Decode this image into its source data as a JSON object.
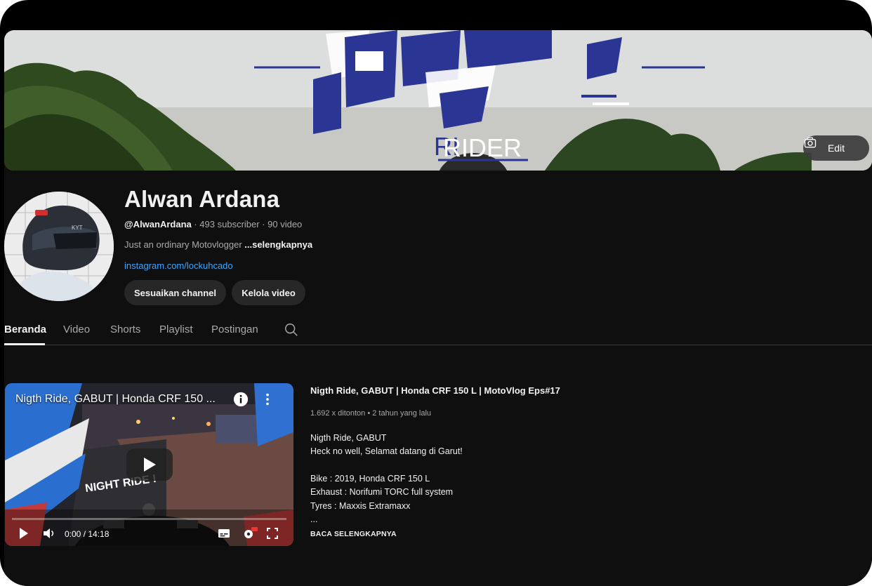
{
  "banner": {
    "overlay_text": "RIDER",
    "edit_label": "Edit"
  },
  "channel": {
    "name": "Alwan Ardana",
    "handle": "@AlwanArdana",
    "stats": " · 493 subscriber · 90 video",
    "description": "Just an ordinary Motovlogger ",
    "more_label": "...selengkapnya",
    "link": "instagram.com/lockuhcado",
    "buttons": {
      "customize": "Sesuaikan channel",
      "manage": "Kelola video"
    }
  },
  "tabs": [
    "Beranda",
    "Video",
    "Shorts",
    "Playlist",
    "Postingan"
  ],
  "featured_video": {
    "player_title": "Nigth Ride, GABUT | Honda CRF 150 ...",
    "title": "Nigth Ride, GABUT | Honda CRF 150 L | MotoVlog Eps#17",
    "meta": "1.692 x ditonton • 2 tahun yang lalu",
    "time": "0:00 / 14:18",
    "thumb_text": "NIGHT RIDE !",
    "description_lines": [
      "Nigth Ride, GABUT",
      "Heck no well, Selamat datang di Garut!",
      "",
      "Bike : 2019, Honda CRF 150 L",
      "Exhaust : Norifumi TORC full system",
      "Tyres : Maxxis Extramaxx",
      "..."
    ],
    "read_more": "BACA SELENGKAPNYA"
  },
  "colors": {
    "background": "#0f0f0f",
    "accent_link": "#3ea6ff",
    "banner_brand": "#2b3593",
    "pill_bg": "#272727"
  }
}
